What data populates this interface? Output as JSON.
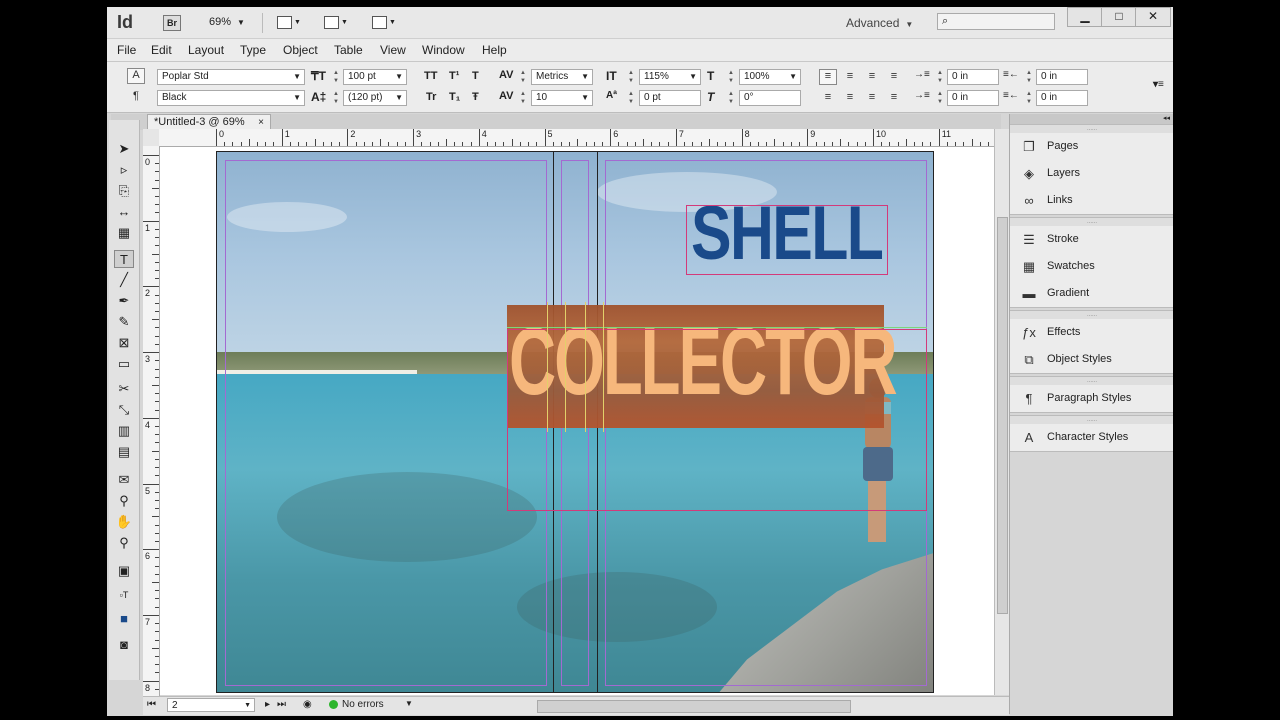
{
  "app": {
    "logo": "Id",
    "bridge": "Br",
    "zoom": "69%",
    "workspace": "Advanced",
    "search_icon": "⌕",
    "window_controls": [
      "▁",
      "□",
      "✕"
    ]
  },
  "menu": [
    "File",
    "Edit",
    "Layout",
    "Type",
    "Object",
    "Table",
    "View",
    "Window",
    "Help"
  ],
  "control": {
    "font_family": "Poplar Std",
    "font_style": "Black",
    "font_size": "100 pt",
    "leading": "(120 pt)",
    "kerning": "Metrics",
    "tracking": "10",
    "vscale": "115%",
    "hscale": "100%",
    "baseline": "0 pt",
    "skew": "0°",
    "indent_left": "0 in",
    "indent_first": "0 in",
    "indent_right": "0 in",
    "indent_last": "0 in",
    "caps_labels": [
      "TT",
      "T¹",
      "T",
      "Tr",
      "T₁",
      "Ŧ"
    ]
  },
  "document": {
    "tab_title": "*Untitled-3 @ 69%",
    "tab_close": "×",
    "headline_top": "SHELL",
    "headline_bottom": "COLLECTOR"
  },
  "ruler": {
    "h_labels": [
      "0",
      "1",
      "2",
      "3",
      "4",
      "5",
      "6",
      "7",
      "8",
      "9",
      "10",
      "11"
    ],
    "v_labels": [
      "0",
      "1",
      "2",
      "3",
      "4",
      "5",
      "6",
      "7",
      "8"
    ]
  },
  "status": {
    "page": "2",
    "errors": "No errors"
  },
  "panels": [
    {
      "items": [
        {
          "label": "Pages",
          "icon": "pages-icon"
        },
        {
          "label": "Layers",
          "icon": "layers-icon"
        },
        {
          "label": "Links",
          "icon": "links-icon"
        }
      ]
    },
    {
      "items": [
        {
          "label": "Stroke",
          "icon": "stroke-icon"
        },
        {
          "label": "Swatches",
          "icon": "swatches-icon"
        },
        {
          "label": "Gradient",
          "icon": "gradient-icon"
        }
      ]
    },
    {
      "items": [
        {
          "label": "Effects",
          "icon": "effects-icon"
        },
        {
          "label": "Object Styles",
          "icon": "object-styles-icon"
        }
      ]
    },
    {
      "items": [
        {
          "label": "Paragraph Styles",
          "icon": "paragraph-styles-icon"
        }
      ]
    },
    {
      "items": [
        {
          "label": "Character Styles",
          "icon": "character-styles-icon"
        }
      ]
    }
  ],
  "colors": {
    "shell_text": "#1a4a8a",
    "collector_text": "#f6b77c",
    "frame": "#d33a7a",
    "status_ok": "#2cb52c"
  }
}
